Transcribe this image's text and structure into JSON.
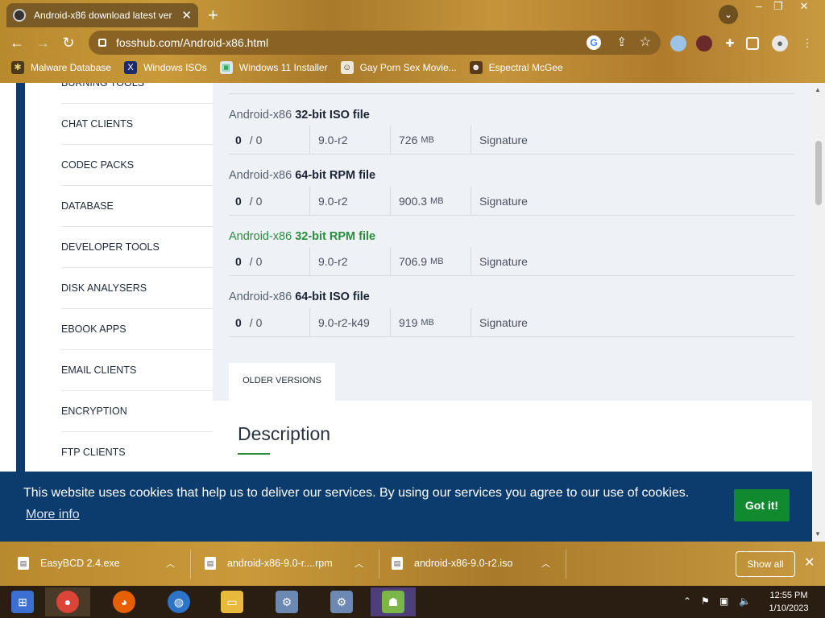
{
  "browser": {
    "tab_title": "Android-x86 download latest ver",
    "url": "fosshub.com/Android-x86.html",
    "bookmarks": [
      {
        "label": "Malware Database"
      },
      {
        "label": "Windows ISOs"
      },
      {
        "label": "Windows 11 Installer"
      },
      {
        "label": "Gay Porn Sex Movie..."
      },
      {
        "label": "Espectral McGee"
      }
    ]
  },
  "sidebar": {
    "items": [
      {
        "label": "Burning Tools"
      },
      {
        "label": "Chat Clients"
      },
      {
        "label": "Codec Packs"
      },
      {
        "label": "Database"
      },
      {
        "label": "Developer Tools"
      },
      {
        "label": "Disk Analysers"
      },
      {
        "label": "eBook Apps"
      },
      {
        "label": "Email Clients"
      },
      {
        "label": "Encryption"
      },
      {
        "label": "FTP Clients"
      }
    ]
  },
  "files": [
    {
      "prefix": "Android-x86",
      "name": "32-bit ISO file",
      "downloads": "0",
      "total": "/ 0",
      "version": "9.0-r2",
      "size": "726",
      "unit": "MB",
      "signature": "Signature"
    },
    {
      "prefix": "Android-x86",
      "name": "64-bit RPM file",
      "downloads": "0",
      "total": "/ 0",
      "version": "9.0-r2",
      "size": "900.3",
      "unit": "MB",
      "signature": "Signature"
    },
    {
      "prefix": "Android-x86",
      "name": "32-bit RPM file",
      "downloads": "0",
      "total": "/ 0",
      "version": "9.0-r2",
      "size": "706.9",
      "unit": "MB",
      "signature": "Signature"
    },
    {
      "prefix": "Android-x86",
      "name": "64-bit ISO file",
      "downloads": "0",
      "total": "/ 0",
      "version": "9.0-r2-k49",
      "size": "919",
      "unit": "MB",
      "signature": "Signature"
    }
  ],
  "older_versions_label": "OLDER VERSIONS",
  "description_heading": "Description",
  "cookie": {
    "text": "This website uses cookies that help us to deliver our services. By using our services you agree to our use of cookies.",
    "more_info": "More info",
    "button": "Got it!"
  },
  "downloads": {
    "items": [
      {
        "name": "EasyBCD 2.4.exe"
      },
      {
        "name": "android-x86-9.0-r....rpm"
      },
      {
        "name": "android-x86-9.0-r2.iso"
      }
    ],
    "show_all": "Show all"
  },
  "taskbar": {
    "time": "12:55 PM",
    "date": "1/10/2023"
  }
}
